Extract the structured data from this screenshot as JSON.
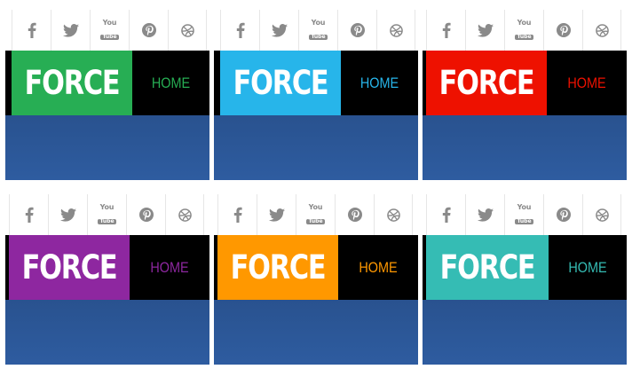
{
  "social_icons": [
    "facebook-icon",
    "twitter-icon",
    "youtube-icon",
    "pinterest-icon",
    "dribbble-icon"
  ],
  "youtube_text": {
    "you": "You",
    "tube": "Tube"
  },
  "variants": [
    {
      "logo": "FORCE",
      "nav_home": "HOME",
      "accent": "#27ae54"
    },
    {
      "logo": "FORCE",
      "nav_home": "HOME",
      "accent": "#27b5ea"
    },
    {
      "logo": "FORCE",
      "nav_home": "HOME",
      "accent": "#ee1100"
    },
    {
      "logo": "FORCE",
      "nav_home": "HOME",
      "accent": "#8e27a0"
    },
    {
      "logo": "FORCE",
      "nav_home": "HOME",
      "accent": "#ff9800"
    },
    {
      "logo": "FORCE",
      "nav_home": "HOME",
      "accent": "#35bcb4"
    }
  ]
}
